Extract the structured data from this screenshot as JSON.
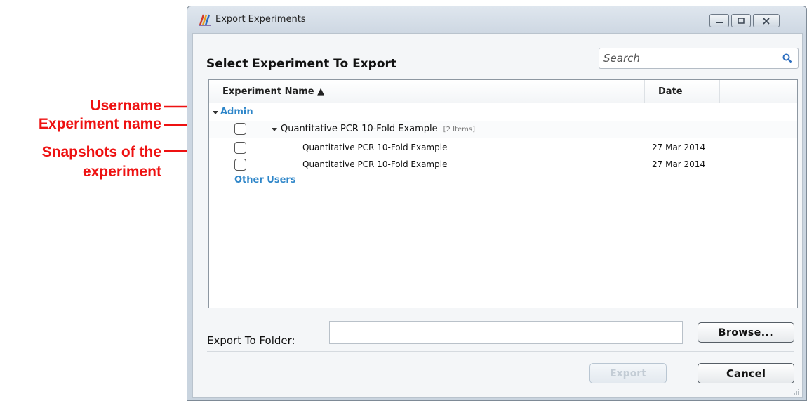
{
  "annotations": {
    "username": "Username",
    "experiment_name": "Experiment name",
    "snapshots_line1": "Snapshots of the",
    "snapshots_line2": "experiment",
    "color": "#ee1111"
  },
  "window": {
    "title": "Export Experiments",
    "heading": "Select Experiment To Export",
    "controls": [
      "minimize-icon",
      "maximize-icon",
      "close-icon"
    ]
  },
  "search": {
    "placeholder": "Search",
    "icon": "search-icon"
  },
  "table": {
    "columns": {
      "name": "Experiment Name ▲",
      "date": "Date"
    },
    "groups": [
      {
        "user": "Admin",
        "expanded": true,
        "experiment": {
          "name": "Quantitative PCR 10-Fold Example",
          "count": "[2 Items]",
          "snapshots": [
            {
              "name": "Quantitative PCR 10-Fold Example",
              "date": "27 Mar 2014"
            },
            {
              "name": "Quantitative PCR 10-Fold Example",
              "date": "27 Mar 2014"
            }
          ]
        }
      },
      {
        "user": "Other Users",
        "expanded": false
      }
    ]
  },
  "footer": {
    "folder_label": "Export To Folder:",
    "folder_value": "",
    "browse_label": "Browse...",
    "export_label": "Export",
    "cancel_label": "Cancel"
  },
  "colors": {
    "accent": "#2e86c9",
    "window_bg": "#cfd9e3"
  }
}
